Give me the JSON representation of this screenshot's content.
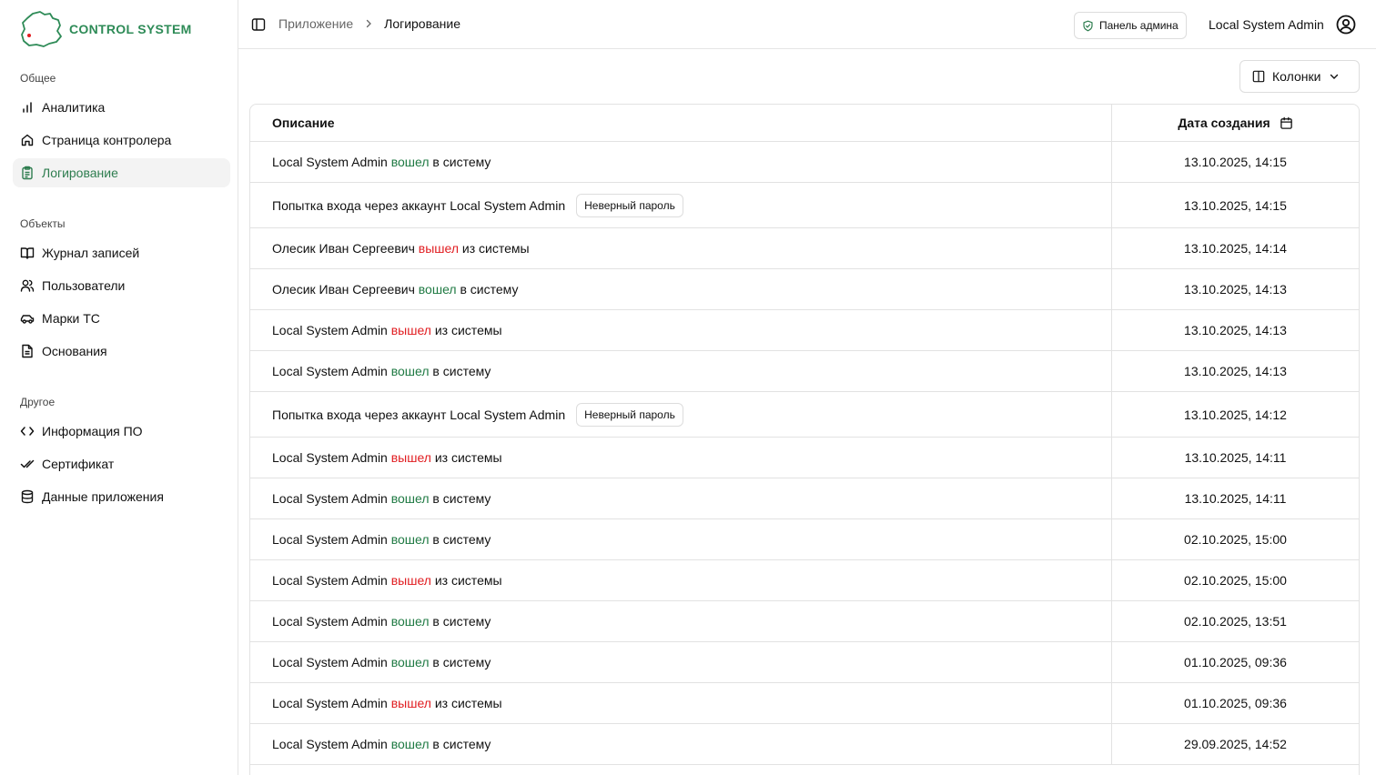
{
  "sidebar": {
    "logo_text": "CONTROL SYSTEM",
    "sections": [
      {
        "label": "Общее",
        "items": [
          {
            "label": "Аналитика",
            "icon": "bar-chart-icon"
          },
          {
            "label": "Страница контролера",
            "icon": "home-icon"
          },
          {
            "label": "Логирование",
            "icon": "clipboard-icon",
            "active": true
          }
        ]
      },
      {
        "label": "Объекты",
        "items": [
          {
            "label": "Журнал записей",
            "icon": "book-icon"
          },
          {
            "label": "Пользователи",
            "icon": "users-icon"
          },
          {
            "label": "Марки ТС",
            "icon": "car-icon"
          },
          {
            "label": "Основания",
            "icon": "file-text-icon"
          }
        ]
      },
      {
        "label": "Другое",
        "items": [
          {
            "label": "Информация ПО",
            "icon": "code-icon"
          },
          {
            "label": "Сертификат",
            "icon": "check-check-icon"
          },
          {
            "label": "Данные приложения",
            "icon": "database-icon"
          }
        ]
      }
    ]
  },
  "header": {
    "breadcrumb_root": "Приложение",
    "breadcrumb_current": "Логирование",
    "admin_panel_label": "Панель админа",
    "user_name": "Local System Admin"
  },
  "toolbar": {
    "columns_label": "Колонки"
  },
  "table": {
    "headers": {
      "description": "Описание",
      "created_at": "Дата создания"
    },
    "rows": [
      {
        "subject": "Local System Admin",
        "verb": "вошел",
        "verb_type": "in",
        "tail": "в систему",
        "date": "13.10.2025, 14:15"
      },
      {
        "subject": "Попытка входа через аккаунт Local System Admin",
        "badge": "Неверный пароль",
        "date": "13.10.2025, 14:15"
      },
      {
        "subject": "Олесик Иван Сергеевич",
        "verb": "вышел",
        "verb_type": "out",
        "tail": "из системы",
        "date": "13.10.2025, 14:14"
      },
      {
        "subject": "Олесик Иван Сергеевич",
        "verb": "вошел",
        "verb_type": "in",
        "tail": "в систему",
        "date": "13.10.2025, 14:13"
      },
      {
        "subject": "Local System Admin",
        "verb": "вышел",
        "verb_type": "out",
        "tail": "из системы",
        "date": "13.10.2025, 14:13"
      },
      {
        "subject": "Local System Admin",
        "verb": "вошел",
        "verb_type": "in",
        "tail": "в систему",
        "date": "13.10.2025, 14:13"
      },
      {
        "subject": "Попытка входа через аккаунт Local System Admin",
        "badge": "Неверный пароль",
        "date": "13.10.2025, 14:12"
      },
      {
        "subject": "Local System Admin",
        "verb": "вышел",
        "verb_type": "out",
        "tail": "из системы",
        "date": "13.10.2025, 14:11"
      },
      {
        "subject": "Local System Admin",
        "verb": "вошел",
        "verb_type": "in",
        "tail": "в систему",
        "date": "13.10.2025, 14:11"
      },
      {
        "subject": "Local System Admin",
        "verb": "вошел",
        "verb_type": "in",
        "tail": "в систему",
        "date": "02.10.2025, 15:00"
      },
      {
        "subject": "Local System Admin",
        "verb": "вышел",
        "verb_type": "out",
        "tail": "из системы",
        "date": "02.10.2025, 15:00"
      },
      {
        "subject": "Local System Admin",
        "verb": "вошел",
        "verb_type": "in",
        "tail": "в систему",
        "date": "02.10.2025, 13:51"
      },
      {
        "subject": "Local System Admin",
        "verb": "вошел",
        "verb_type": "in",
        "tail": "в систему",
        "date": "01.10.2025, 09:36"
      },
      {
        "subject": "Local System Admin",
        "verb": "вышел",
        "verb_type": "out",
        "tail": "из системы",
        "date": "01.10.2025, 09:36"
      },
      {
        "subject": "Local System Admin",
        "verb": "вошел",
        "verb_type": "in",
        "tail": "в систему",
        "date": "29.09.2025, 14:52"
      }
    ]
  },
  "colors": {
    "accent": "#2e7d4f",
    "logged_in": "#1f7a43",
    "logged_out": "#e11d21"
  }
}
